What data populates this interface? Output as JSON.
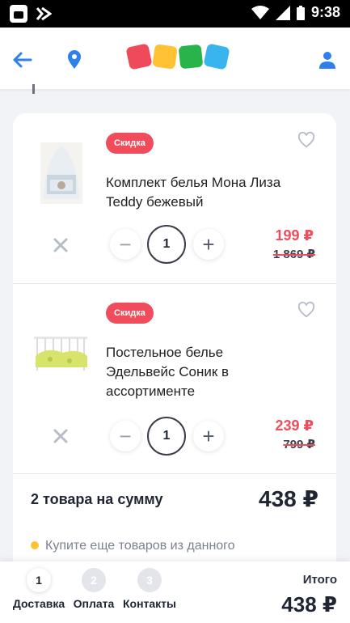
{
  "status_bar": {
    "time": "9:38"
  },
  "colors": {
    "accent_blue": "#2f80ed",
    "discount_red": "#f04c5b",
    "logo": [
      "#ef4a5b",
      "#ffc234",
      "#28b34b",
      "#38b5ef"
    ]
  },
  "header": {
    "back_icon": "arrow-left-icon",
    "location_icon": "map-pin-icon",
    "profile_icon": "user-icon"
  },
  "cart": {
    "items": [
      {
        "badge": "Скидка",
        "title": "Комплект белья Мона Лиза Teddy бежевый",
        "quantity": "1",
        "price": "199 ₽",
        "old_price": "1 869 ₽"
      },
      {
        "badge": "Скидка",
        "title": "Постельное белье Эдельвейс Соник в ассортименте",
        "quantity": "1",
        "price": "239 ₽",
        "old_price": "799 ₽"
      }
    ],
    "summary_label": "2 товара на сумму",
    "summary_total": "438 ₽",
    "hint": "Купите еще товаров из данного"
  },
  "checkout": {
    "steps": [
      {
        "number": "1",
        "label": "Доставка",
        "active": true
      },
      {
        "number": "2",
        "label": "Оплата",
        "active": false
      },
      {
        "number": "3",
        "label": "Контакты",
        "active": false
      }
    ],
    "total_label": "Итого",
    "total_value": "438 ₽"
  }
}
